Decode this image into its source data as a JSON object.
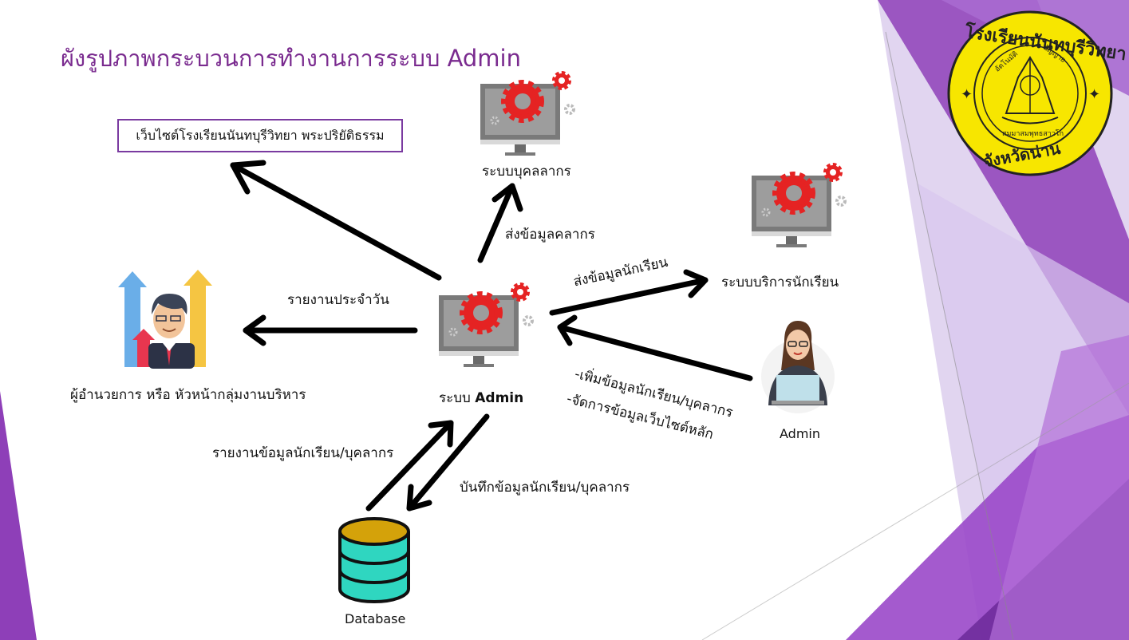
{
  "title": "ผังรูปภาพกระบวนการทำงานการระบบ Admin",
  "website_box": "เว็บไซต์โรงเรียนนันทบุรีวิทยา พระปริยัติธรรม",
  "school_logo": {
    "top_text": "โรงเรียนนันทบุรีวิทยา",
    "bottom_text": "จังหวัดน่าน",
    "inner_left": "อัตโนมัติ",
    "inner_right": "ปัญญาย",
    "inner_bottom": "สมมาสมพุทธสาวโก"
  },
  "nodes": {
    "personnel_system": "ระบบบุคลลากร",
    "student_service": "ระบบบริการนักเรียน",
    "admin_system_prefix": "ระบบ",
    "admin_system_bold": "Admin",
    "director": "ผู้อำนวยการ หรือ หัวหน้ากลุ่มงานบริหาร",
    "admin_person": "Admin",
    "database": "Database"
  },
  "edges": {
    "send_personnel": "ส่งข้อมูลคลากร",
    "send_student": "ส่งข้อมูลนักเรียน",
    "daily_report": "รายงานประจำวัน",
    "add_data": "-เพิ่มข้อมูลนักเรียน/บุคลากร",
    "manage_web": "-จัดการข้อมูลเว็บไซต์หลัก",
    "report_data": "รายงานข้อมูลนักเรียน/บุคลากร",
    "save_data": "บันทึกข้อมูลนักเรียน/บุคลากร"
  },
  "colors": {
    "title": "#7a2b8f",
    "accent_purple": "#8e3fb8",
    "gear_red": "#e52323",
    "arrow": "#000000",
    "logo_yellow": "#f7e600",
    "db_gold": "#d4a20a",
    "db_teal": "#2fd6c0"
  },
  "icons": {
    "computer": "computer-gear-icon",
    "database": "database-icon",
    "manager": "manager-growth-icon",
    "admin": "admin-woman-icon"
  }
}
